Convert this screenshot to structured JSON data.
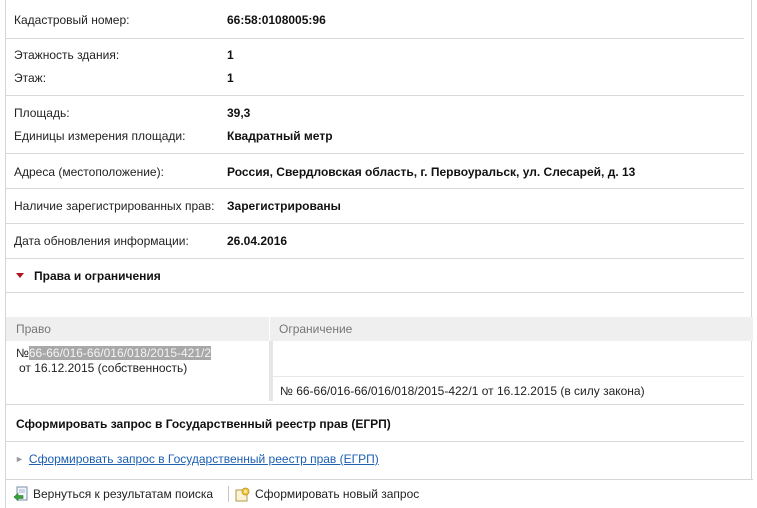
{
  "info": {
    "cadastral_label": "Кадастровый номер:",
    "cadastral_value": "66:58:0108005:96",
    "floors_label": "Этажность здания:",
    "floors_value": "1",
    "floor_label": "Этаж:",
    "floor_value": "1",
    "area_label": "Площадь:",
    "area_value": "39,3",
    "area_unit_label": "Единицы измерения площади:",
    "area_unit_value": "Квадратный метр",
    "address_label": "Адреса (местоположение):",
    "address_value": "Россия, Свердловская область, г. Первоуральск, ул. Слесарей, д. 13",
    "rights_label": "Наличие зарегистрированных прав:",
    "rights_value": "Зарегистрированы",
    "update_label": "Дата обновления информации:",
    "update_value": "26.04.2016"
  },
  "section": {
    "title": "Права и ограничения"
  },
  "table": {
    "col_right": "Право",
    "col_restriction": "Ограничение",
    "right_prefix": "№",
    "right_number": "66-66/016-66/016/018/2015-421/2",
    "right_date": "от 16.12.2015  (собственность)",
    "restriction_text": "№ 66-66/016-66/016/018/2015-422/1  от 16.12.2015  (в силу закона)"
  },
  "request": {
    "title": "Сформировать запрос в Государственный реестр прав (ЕГРП)",
    "link": "Сформировать запрос в Государственный реестр прав (ЕГРП)"
  },
  "bottom": {
    "back_label": "Вернуться к результатам поиска",
    "new_request_label": "Сформировать новый запрос"
  },
  "colors": {
    "accent_link": "#1d5fb1",
    "triangle": "#b0141c"
  }
}
